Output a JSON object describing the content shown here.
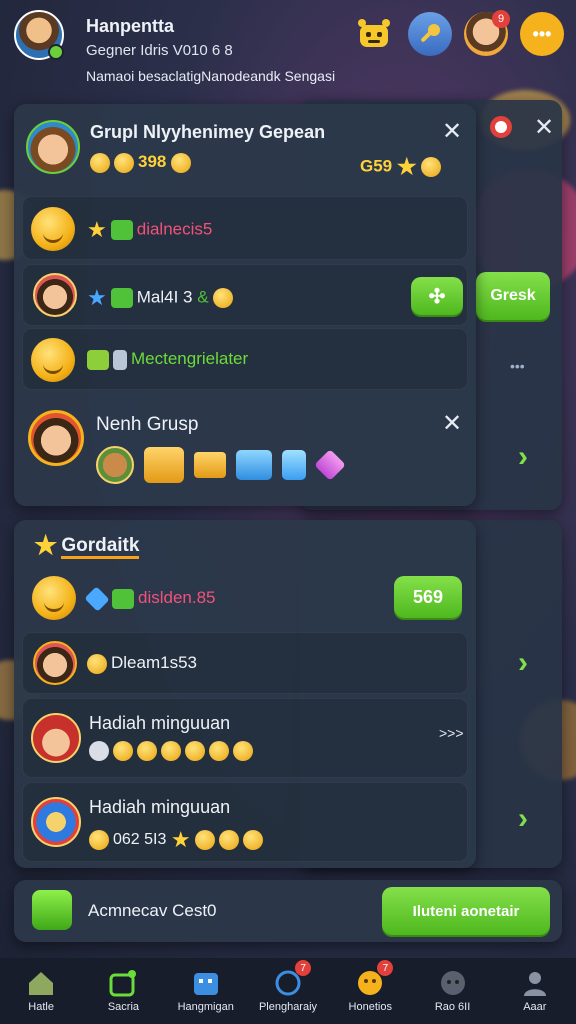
{
  "header": {
    "title": "Hanpentta",
    "subtitle": "Gegner Idris V010 6 8",
    "status": "Namaoi besaclatigNanodeandk Sengasi",
    "icons": [
      "robot-icon",
      "key-icon",
      "friend-avatar-icon",
      "more-icon"
    ],
    "friend_badge": "9",
    "more_label": "•••"
  },
  "top_panel": {
    "title": "Grupl Nlyyhenimey Gepean",
    "stat_value": "398",
    "stat_right": "G59",
    "rows": [
      {
        "label": "dialnecis5"
      },
      {
        "label": "Mal4I 3",
        "suffix": "&",
        "button": "Gresk"
      },
      {
        "label": "Mectengrielater"
      }
    ],
    "group_name": "Nenh Grusp"
  },
  "behind_panel": {
    "dots": "•••",
    "button": "Gresk"
  },
  "lower_panel": {
    "title": "Gordaitk",
    "rows": [
      {
        "label": "dislden.85",
        "button": "569"
      },
      {
        "label": "Dleam1s53"
      },
      {
        "title": "Hadiah minguuan",
        "more": ">>>"
      },
      {
        "title": "Hadiah minguuan",
        "value": "062 5I3"
      }
    ]
  },
  "bottom_bar": {
    "label": "Acmnecav Cest0",
    "button": "Iluteni aonetair"
  },
  "nav": [
    {
      "label": "Hatle"
    },
    {
      "label": "Sacria"
    },
    {
      "label": "Hangmigan"
    },
    {
      "label": "Plengharaiy",
      "badge": "7"
    },
    {
      "label": "Honetios",
      "badge": "7"
    },
    {
      "label": "Rao 6II"
    },
    {
      "label": "Aaar"
    }
  ]
}
